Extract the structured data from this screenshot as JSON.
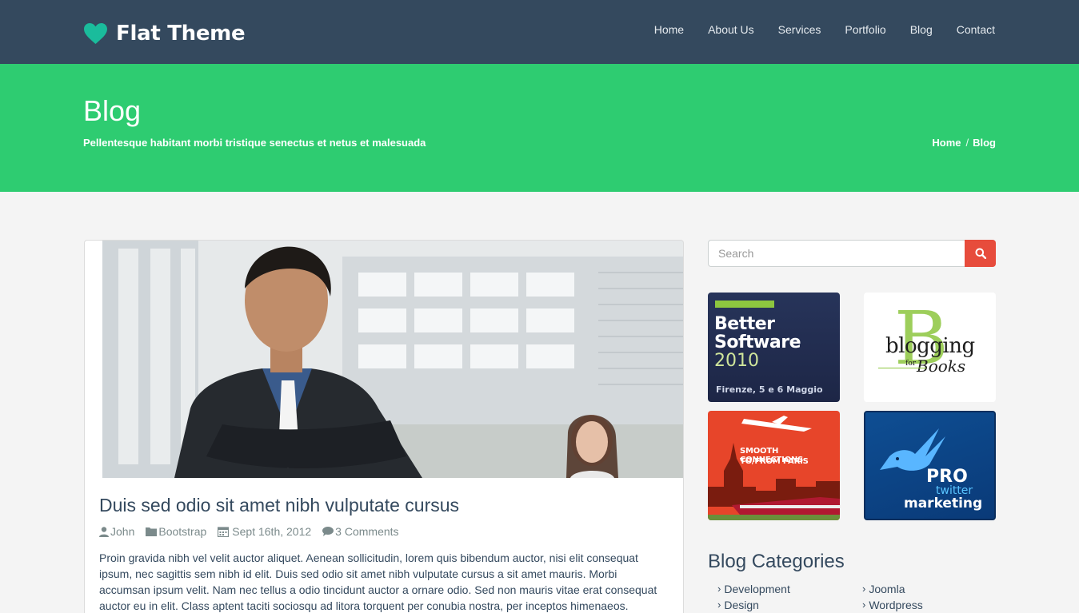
{
  "brand": {
    "name": "Flat Theme",
    "icon": "heart-icon",
    "icon_color": "#1abc9c"
  },
  "nav": {
    "items": [
      {
        "label": "Home"
      },
      {
        "label": "About Us"
      },
      {
        "label": "Services"
      },
      {
        "label": "Portfolio"
      },
      {
        "label": "Blog"
      },
      {
        "label": "Contact"
      }
    ]
  },
  "header": {
    "title": "Blog",
    "subtitle": "Pellentesque habitant morbi tristique senectus et netus et malesuada",
    "breadcrumb": [
      {
        "label": "Home"
      },
      {
        "label": "Blog"
      }
    ],
    "breadcrumb_separator": "/"
  },
  "post": {
    "title": "Duis sed odio sit amet nibh vulputate cursus",
    "author": "John",
    "category": "Bootstrap",
    "date": "Sept 16th, 2012",
    "comments": "3 Comments",
    "excerpt": "Proin gravida nibh vel velit auctor aliquet. Aenean sollicitudin, lorem quis bibendum auctor, nisi elit consequat ipsum, nec sagittis sem nibh id elit. Duis sed odio sit amet nibh vulputate cursus a sit amet mauris. Morbi accumsan ipsum velit. Nam nec tellus a odio tincidunt auctor a ornare odio. Sed non mauris vitae erat consequat auctor eu in elit. Class aptent taciti sociosqu ad litora torquent per conubia nostra, per inceptos himenaeos."
  },
  "sidebar": {
    "search": {
      "placeholder": "Search",
      "value": ""
    },
    "ads": [
      {
        "line1": "Better",
        "line2": "Software",
        "line3": "2010",
        "footer": "Firenze, 5 e 6 Maggio"
      },
      {
        "line1": "blogging",
        "line2": "for",
        "line3": "Books",
        "letter": "B"
      },
      {
        "line1": "SMOOTH CONNECTIONS",
        "line2": "TO/FROM PARIS"
      },
      {
        "line1": "PRO",
        "line2": "twitter",
        "line3": "marketing"
      }
    ],
    "categories_title": "Blog Categories",
    "categories": [
      {
        "label": "Development"
      },
      {
        "label": "Joomla"
      },
      {
        "label": "Design"
      },
      {
        "label": "Wordpress"
      }
    ]
  },
  "colors": {
    "navbar": "#34495e",
    "titleband": "#2ecc71",
    "search_button": "#e74c3c",
    "page_bg": "#f4f4f4"
  }
}
